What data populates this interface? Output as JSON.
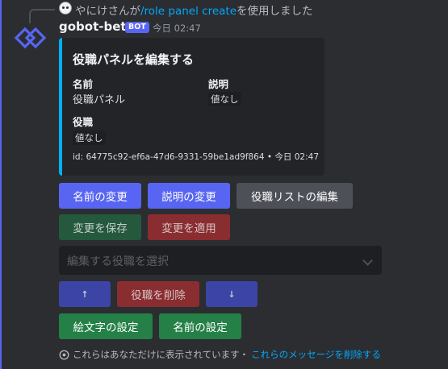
{
  "reply": {
    "user": "やにけさんが",
    "command": "/role panel create",
    "suffix": "を使用しました"
  },
  "message": {
    "username": "gobot-beta",
    "badge": "BOT",
    "timestamp": "今日 02:47"
  },
  "embed": {
    "title": "役職パネルを編集する",
    "accent_color": "#00b0f4",
    "fields": {
      "name_label": "名前",
      "name_value": "役職パネル",
      "desc_label": "説明",
      "desc_value": "値なし",
      "roles_label": "役職",
      "roles_value": "値なし"
    },
    "footer": "id: 64775c92-ef6a-47d6-9331-59be1ad9f864 • 今日 02:47"
  },
  "buttons": {
    "change_name": "名前の変更",
    "change_desc": "説明の変更",
    "edit_role_list": "役職リストの編集",
    "save_changes": "変更を保存",
    "apply_changes": "変更を適用",
    "move_up": "↑",
    "delete_role": "役職を削除",
    "move_down": "↓",
    "emoji_settings": "絵文字の設定",
    "name_settings": "名前の設定"
  },
  "select": {
    "placeholder": "編集する役職を選択"
  },
  "ephemeral": {
    "notice": "これらはあなただけに表示されています・",
    "dismiss_link": "これらのメッセージを削除する"
  },
  "colors": {
    "primary": "#5865f2",
    "secondary": "#4e5058",
    "success": "#248046",
    "danger": "#da373c",
    "background": "#2b2d31",
    "link": "#00a8fc"
  }
}
